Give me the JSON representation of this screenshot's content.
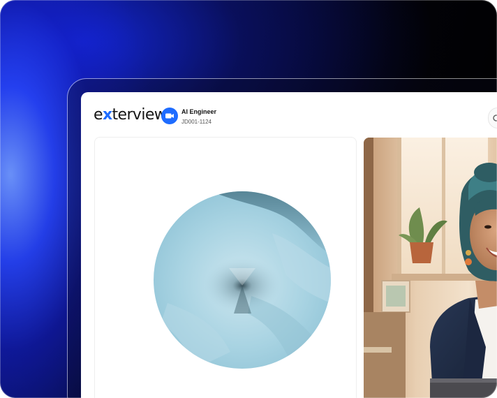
{
  "app": {
    "logo_text_start": "e",
    "logo_text_x": "x",
    "logo_text_end": "terview"
  },
  "header": {
    "job_title": "AI Engineer",
    "job_id": "JD001-1124"
  },
  "icons": {
    "camera": "video-camera-icon",
    "top_right": "settings-icon"
  },
  "colors": {
    "brand_blue": "#1e6cff",
    "orb_base": "#9fcbdc"
  }
}
